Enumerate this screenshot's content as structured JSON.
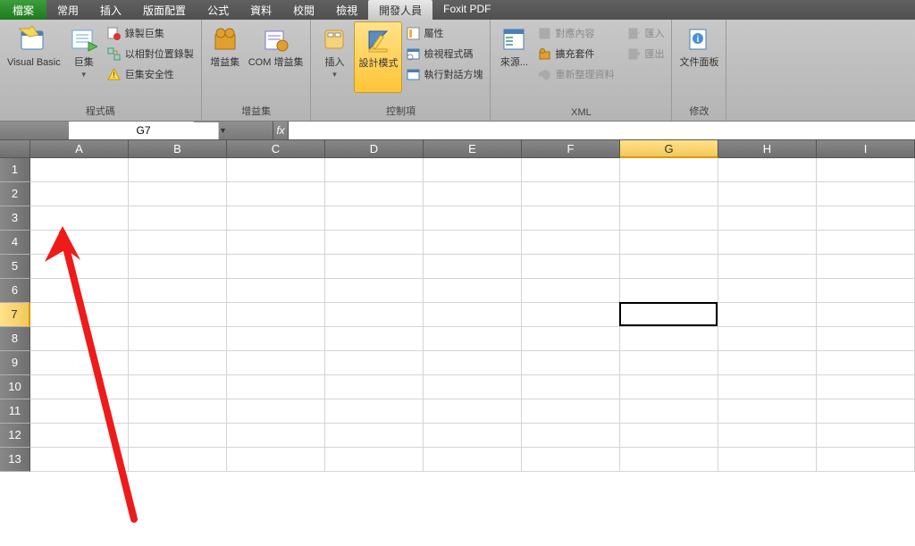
{
  "tabs": {
    "file": "檔案",
    "items": [
      "常用",
      "插入",
      "版面配置",
      "公式",
      "資料",
      "校閱",
      "檢視",
      "開發人員",
      "Foxit PDF"
    ],
    "active_index": 7
  },
  "ribbon": {
    "code": {
      "label": "程式碼",
      "vb": "Visual Basic",
      "macros": "巨集",
      "record": "錄製巨集",
      "relative": "以相對位置錄製",
      "security": "巨集安全性"
    },
    "addins": {
      "label": "增益集",
      "addins": "增益集",
      "com": "COM 增益集"
    },
    "controls": {
      "label": "控制項",
      "insert": "插入",
      "design": "設計模式",
      "properties": "屬性",
      "view_code": "檢視程式碼",
      "run_dialog": "執行對話方塊"
    },
    "xml": {
      "label": "XML",
      "source": "來源...",
      "map_props": "對應內容",
      "expansion": "擴充套件",
      "refresh": "重新整理資料",
      "import": "匯入",
      "export": "匯出"
    },
    "modify": {
      "label": "修改",
      "doc_panel": "文件面板"
    }
  },
  "formula_bar": {
    "name_box": "G7",
    "fx": "fx",
    "formula": ""
  },
  "grid": {
    "columns": [
      "A",
      "B",
      "C",
      "D",
      "E",
      "F",
      "G",
      "H",
      "I"
    ],
    "rows": [
      1,
      2,
      3,
      4,
      5,
      6,
      7,
      8,
      9,
      10,
      11,
      12,
      13
    ],
    "selected_col": "G",
    "selected_row": 7
  }
}
